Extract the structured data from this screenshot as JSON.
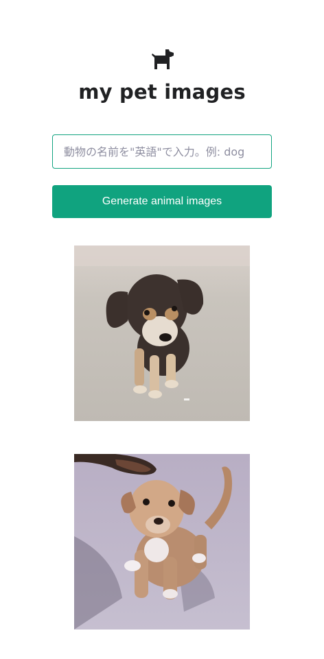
{
  "app": {
    "title": "my pet images",
    "logo_icon": "dog-icon"
  },
  "form": {
    "input_placeholder": "動物の名前を\"英語\"で入力。例: dog",
    "input_value": "",
    "button_label": "Generate animal images"
  },
  "colors": {
    "accent": "#10a37f",
    "title": "#202123",
    "placeholder": "#8e8ea0"
  },
  "results": [
    {
      "subject": "black-and-tan-puppy-photo"
    },
    {
      "subject": "tan-puppy-photo"
    }
  ]
}
